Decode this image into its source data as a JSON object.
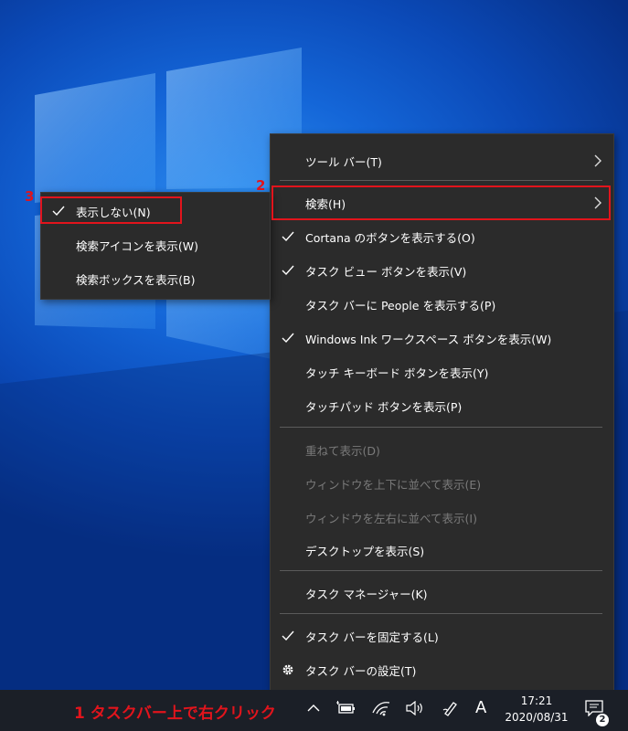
{
  "main_menu": {
    "items": [
      {
        "label": "ツール バー(T)",
        "checked": false,
        "submenu": true,
        "disabled": false
      },
      {
        "label": "検索(H)",
        "checked": false,
        "submenu": true,
        "disabled": false
      },
      {
        "label": "Cortana のボタンを表示する(O)",
        "checked": true,
        "submenu": false,
        "disabled": false
      },
      {
        "label": "タスク ビュー ボタンを表示(V)",
        "checked": true,
        "submenu": false,
        "disabled": false
      },
      {
        "label": "タスク バーに People を表示する(P)",
        "checked": false,
        "submenu": false,
        "disabled": false
      },
      {
        "label": "Windows Ink ワークスペース ボタンを表示(W)",
        "checked": true,
        "submenu": false,
        "disabled": false
      },
      {
        "label": "タッチ キーボード ボタンを表示(Y)",
        "checked": false,
        "submenu": false,
        "disabled": false
      },
      {
        "label": "タッチパッド ボタンを表示(P)",
        "checked": false,
        "submenu": false,
        "disabled": false
      },
      {
        "label": "重ねて表示(D)",
        "checked": false,
        "submenu": false,
        "disabled": true
      },
      {
        "label": "ウィンドウを上下に並べて表示(E)",
        "checked": false,
        "submenu": false,
        "disabled": true
      },
      {
        "label": "ウィンドウを左右に並べて表示(I)",
        "checked": false,
        "submenu": false,
        "disabled": true
      },
      {
        "label": "デスクトップを表示(S)",
        "checked": false,
        "submenu": false,
        "disabled": false
      },
      {
        "label": "タスク マネージャー(K)",
        "checked": false,
        "submenu": false,
        "disabled": false
      },
      {
        "label": "タスク バーを固定する(L)",
        "checked": true,
        "submenu": false,
        "disabled": false
      },
      {
        "label": "タスク バーの設定(T)",
        "checked": false,
        "submenu": false,
        "disabled": false,
        "icon": "gear-icon"
      }
    ]
  },
  "sub_menu": {
    "items": [
      {
        "label": "表示しない(N)",
        "checked": true
      },
      {
        "label": "検索アイコンを表示(W)",
        "checked": false
      },
      {
        "label": "検索ボックスを表示(B)",
        "checked": false
      }
    ]
  },
  "annotations": {
    "step1": "1 タスクバー上で右クリック",
    "step2": "2",
    "step3": "3",
    "highlight_color": "#e2141c"
  },
  "taskbar": {
    "clock_time": "17:21",
    "clock_date": "2020/08/31",
    "ime_indicator": "A",
    "notification_count": "2",
    "tray_icons": [
      "chevron-up-icon",
      "battery-icon",
      "wifi-icon",
      "volume-icon",
      "pen-icon"
    ]
  }
}
